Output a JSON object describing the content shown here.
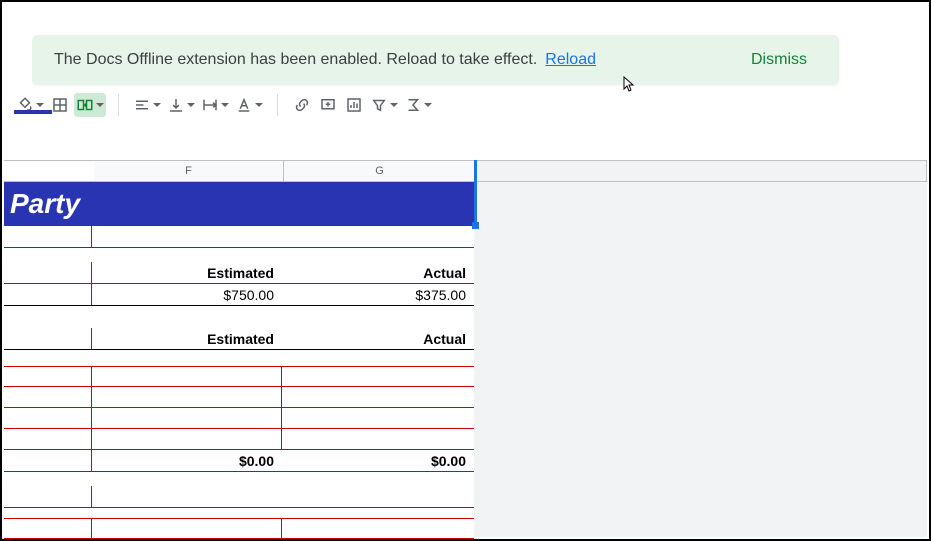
{
  "notification": {
    "message": "The Docs Offline extension has been enabled. Reload to take effect.",
    "reload": "Reload",
    "dismiss": "Dismiss"
  },
  "columns": {
    "f": "F",
    "g": "G"
  },
  "title": "Party",
  "section1": {
    "estimated_label": "Estimated",
    "actual_label": "Actual",
    "estimated_value": "$750.00",
    "actual_value": "$375.00"
  },
  "section2": {
    "estimated_label": "Estimated",
    "actual_label": "Actual",
    "total_estimated": "$0.00",
    "total_actual": "$0.00"
  }
}
